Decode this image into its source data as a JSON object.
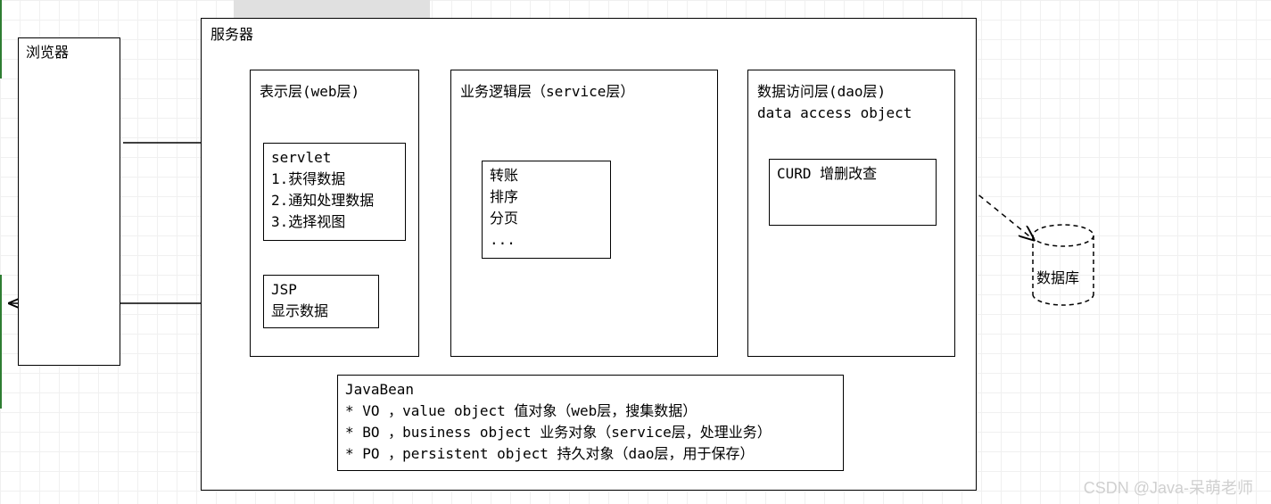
{
  "browser_label": "浏览器",
  "server_label": "服务器",
  "web_layer": {
    "title": "表示层(web层)",
    "servlet_box": "servlet\n1.获得数据\n2.通知处理数据\n3.选择视图",
    "jsp_box": "JSP\n显示数据"
  },
  "service_layer": {
    "title": "业务逻辑层（service层）",
    "ops_box": "转账\n排序\n分页\n..."
  },
  "dao_layer": {
    "title": "数据访问层(dao层)\ndata access object",
    "curd_box": "CURD 增删改查"
  },
  "javabean_box": "JavaBean\n* VO ，value object 值对象（web层，搜集数据）\n* BO ，business object 业务对象（service层，处理业务）\n* PO ，persistent object 持久对象（dao层，用于保存）",
  "database_label": "数据库",
  "watermark": "CSDN @Java-呆萌老师"
}
